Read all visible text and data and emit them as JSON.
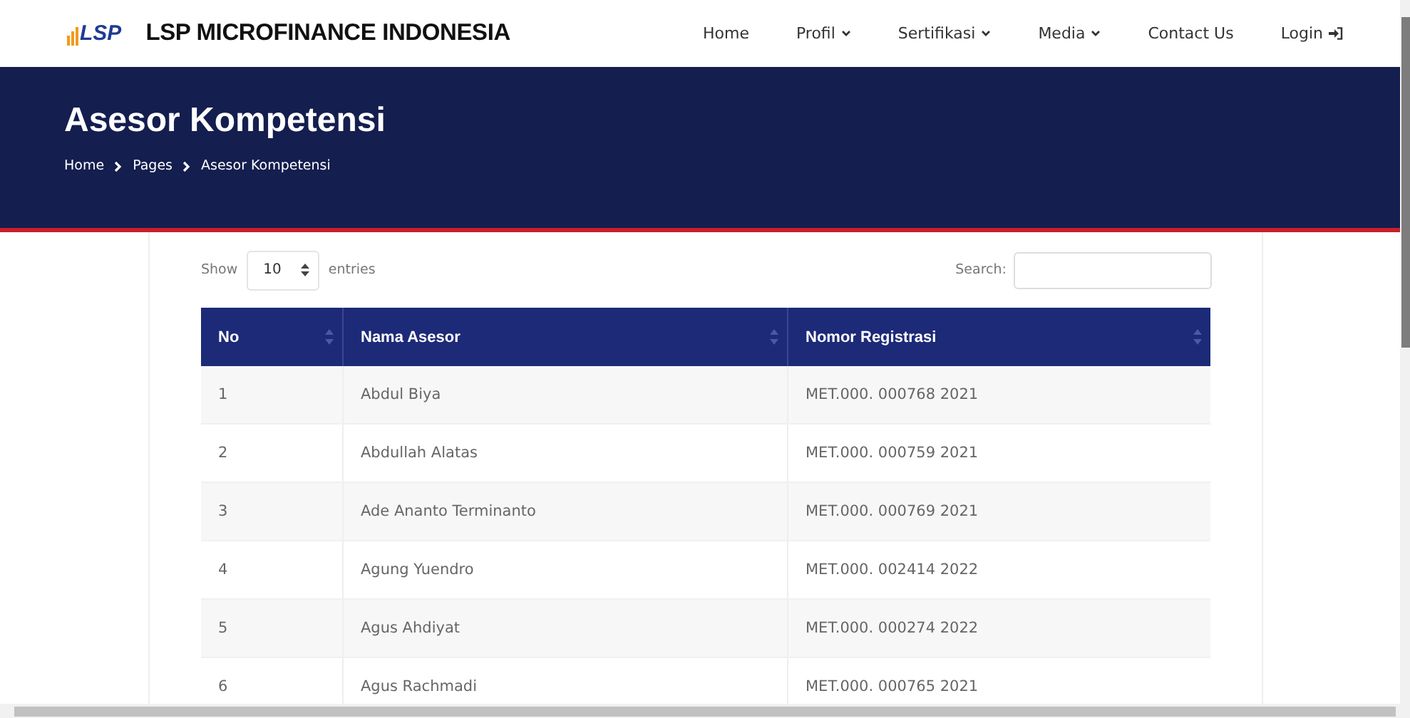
{
  "header": {
    "logo_text": "LSP",
    "brand": "LSP MICROFINANCE INDONESIA",
    "nav": [
      {
        "label": "Home",
        "kind": "link"
      },
      {
        "label": "Profil",
        "kind": "dropdown"
      },
      {
        "label": "Sertifikasi",
        "kind": "dropdown"
      },
      {
        "label": "Media",
        "kind": "dropdown"
      },
      {
        "label": "Contact Us",
        "kind": "link"
      },
      {
        "label": "Login",
        "kind": "login"
      }
    ]
  },
  "banner": {
    "title": "Asesor Kompetensi",
    "breadcrumb": [
      "Home",
      "Pages",
      "Asesor Kompetensi"
    ]
  },
  "table_controls": {
    "show_label": "Show",
    "page_size": "10",
    "entries_label": "entries",
    "search_label": "Search:"
  },
  "table": {
    "columns": [
      "No",
      "Nama Asesor",
      "Nomor Registrasi"
    ],
    "rows": [
      [
        "1",
        "Abdul Biya",
        "MET.000. 000768 2021"
      ],
      [
        "2",
        "Abdullah Alatas",
        "MET.000. 000759 2021"
      ],
      [
        "3",
        "Ade Ananto Terminanto",
        "MET.000. 000769 2021"
      ],
      [
        "4",
        "Agung Yuendro",
        "MET.000. 002414 2022"
      ],
      [
        "5",
        "Agus Ahdiyat",
        "MET.000. 000274 2022"
      ],
      [
        "6",
        "Agus Rachmadi",
        "MET.000. 000765 2021"
      ]
    ]
  }
}
